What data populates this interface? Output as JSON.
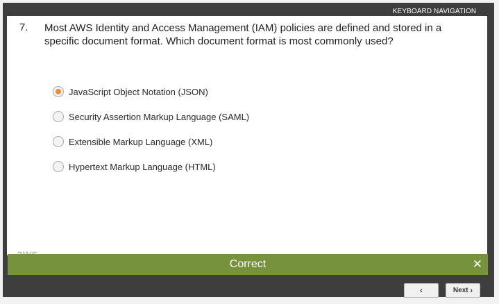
{
  "header": {
    "keyboard_nav_label": "KEYBOARD NAVIGATION"
  },
  "question": {
    "number": "7.",
    "text": "Most AWS Identity and Access Management (IAM) policies are defined and stored in a specific document format. Which document format is most commonly used?"
  },
  "options": [
    {
      "label": "JavaScript Object Notation (JSON)",
      "selected": true
    },
    {
      "label": "Security Assertion Markup Language (SAML)",
      "selected": false
    },
    {
      "label": "Extensible Markup Language (XML)",
      "selected": false
    },
    {
      "label": "Hypertext Markup Language (HTML)",
      "selected": false
    }
  ],
  "feedback": {
    "text": "Correct",
    "close_symbol": "✕"
  },
  "nav": {
    "prev_symbol": "‹",
    "next_label": "Next",
    "next_symbol": "›"
  },
  "colors": {
    "accent": "#76923c",
    "radio_selected": "#f08a3c",
    "frame": "#3e3e3e"
  }
}
